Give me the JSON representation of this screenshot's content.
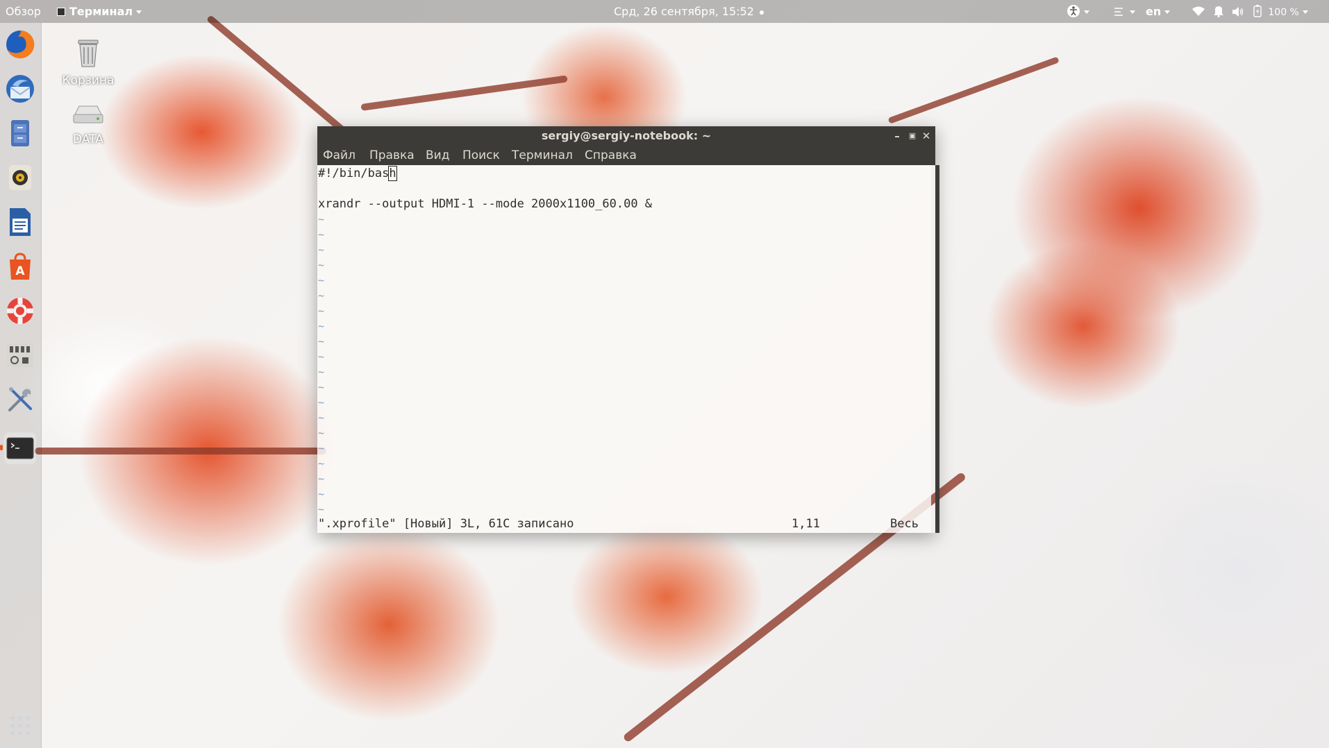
{
  "topbar": {
    "overview": "Обзор",
    "app_menu": "Терминал",
    "datetime": "Срд, 26 сентября, 15:52",
    "language": "en",
    "battery": "100 %"
  },
  "desktop_icons": [
    {
      "label": "Корзина",
      "icon": "trash-icon"
    },
    {
      "label": "DATA",
      "icon": "drive-icon"
    }
  ],
  "dock": [
    {
      "name": "firefox",
      "icon": "firefox-icon"
    },
    {
      "name": "thunderbird",
      "icon": "thunderbird-icon"
    },
    {
      "name": "files",
      "icon": "files-icon"
    },
    {
      "name": "rhythmbox",
      "icon": "rhythmbox-icon"
    },
    {
      "name": "libreoffice-writer",
      "icon": "writer-icon"
    },
    {
      "name": "software-center",
      "icon": "software-icon"
    },
    {
      "name": "help",
      "icon": "help-icon"
    },
    {
      "name": "system-monitor",
      "icon": "monitor-icon"
    },
    {
      "name": "settings",
      "icon": "tools-icon"
    },
    {
      "name": "terminal",
      "icon": "terminal-icon"
    },
    {
      "name": "show-applications",
      "icon": "apps-grid-icon"
    }
  ],
  "terminal": {
    "title": "sergiy@sergiy-notebook: ~",
    "menu": [
      "Файл",
      "Правка",
      "Вид",
      "Поиск",
      "Терминал",
      "Справка"
    ],
    "line1_before_cursor": "#!/bin/bas",
    "line1_cursor": "h",
    "line3": "xrandr --output HDMI-1 --mode 2000x1100_60.00 &",
    "tilde": "~",
    "status_file": "\".xprofile\" [Новый] 3L, 61C записано",
    "status_pos": "1,11",
    "status_scope": "Весь"
  },
  "colors": {
    "accent": "#e95420",
    "titlebar": "#3c3b37",
    "vim_tilde": "#7f9ec4"
  }
}
